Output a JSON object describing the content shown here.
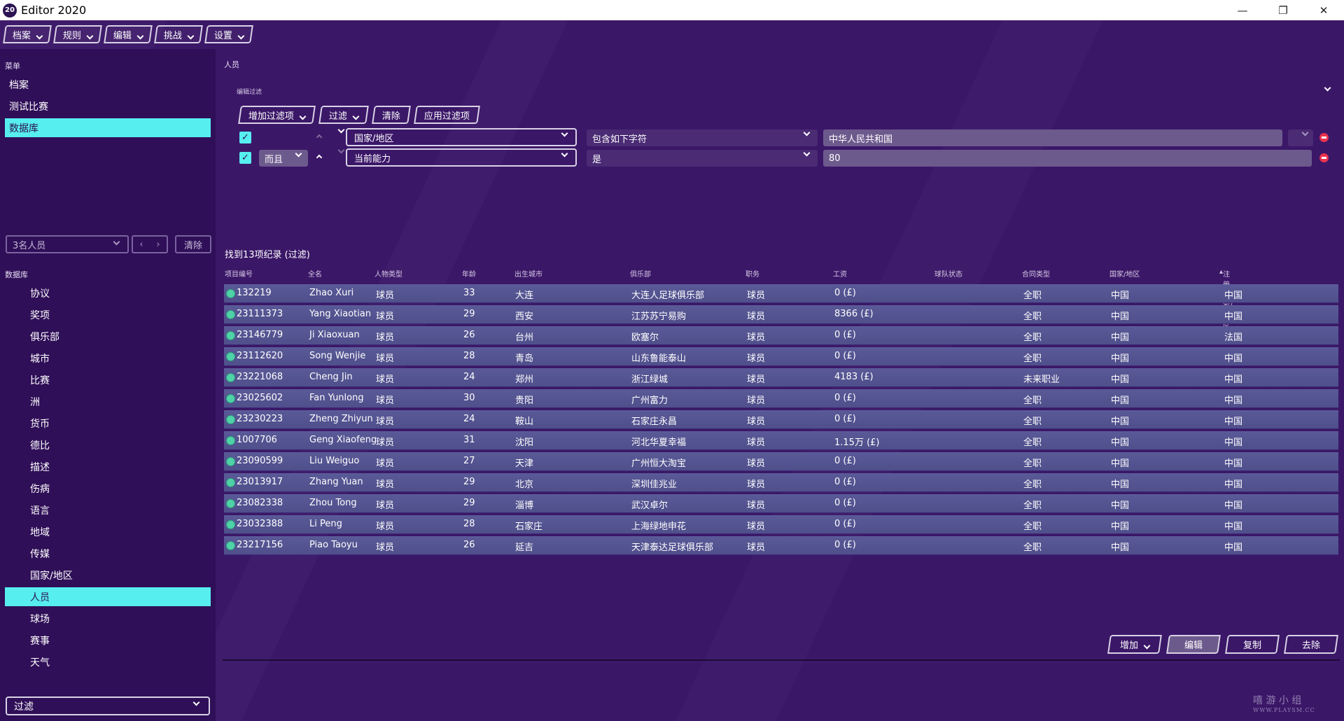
{
  "window": {
    "title": "Editor 2020",
    "icon_label": "20"
  },
  "topmenu": [
    {
      "label": "档案"
    },
    {
      "label": "规则"
    },
    {
      "label": "编辑"
    },
    {
      "label": "挑战"
    },
    {
      "label": "设置"
    }
  ],
  "sidebar": {
    "menu_heading": "菜单",
    "menu_items": [
      "档案",
      "测试比赛",
      "数据库"
    ],
    "active_menu": "数据库",
    "people_select": "3名人员",
    "clear_label": "清除",
    "db_heading": "数据库",
    "db_items": [
      "协议",
      "奖项",
      "俱乐部",
      "城市",
      "比赛",
      "洲",
      "货币",
      "德比",
      "描述",
      "伤病",
      "语言",
      "地域",
      "传媒",
      "国家/地区",
      "人员",
      "球场",
      "赛事",
      "天气"
    ],
    "active_db": "人员",
    "filter_label": "过滤"
  },
  "content": {
    "title": "人员",
    "edit_filter_label": "编辑过滤",
    "toolbar": {
      "add_filter": "增加过滤项",
      "filter": "过滤",
      "clear": "清除",
      "apply": "应用过滤项"
    },
    "filters": [
      {
        "connector": "",
        "field": "国家/地区",
        "operator": "包含如下字符",
        "value": "中华人民共和国"
      },
      {
        "connector": "而且",
        "field": "当前能力",
        "operator": "是",
        "value": "80"
      }
    ],
    "found_text": "找到13项纪录 (过滤)",
    "columns": [
      "项目编号",
      "全名",
      "人物类型",
      "年龄",
      "出生城市",
      "俱乐部",
      "职务",
      "工资",
      "球队状态",
      "合同类型",
      "国家/地区",
      "注册国家/地区"
    ],
    "rows": [
      [
        "132219",
        "Zhao Xuri",
        "球员",
        "33",
        "大连",
        "大连人足球俱乐部",
        "球员",
        "0 (£)",
        "",
        "全职",
        "中国",
        "中国"
      ],
      [
        "23111373",
        "Yang Xiaotian",
        "球员",
        "29",
        "西安",
        "江苏苏宁易购",
        "球员",
        "8366 (£)",
        "",
        "全职",
        "中国",
        "中国"
      ],
      [
        "23146779",
        "Ji Xiaoxuan",
        "球员",
        "26",
        "台州",
        "欧塞尔",
        "球员",
        "0 (£)",
        "",
        "全职",
        "中国",
        "法国"
      ],
      [
        "23112620",
        "Song Wenjie",
        "球员",
        "28",
        "青岛",
        "山东鲁能泰山",
        "球员",
        "0 (£)",
        "",
        "全职",
        "中国",
        "中国"
      ],
      [
        "23221068",
        "Cheng Jin",
        "球员",
        "24",
        "郑州",
        "浙江绿城",
        "球员",
        "4183 (£)",
        "",
        "未来职业",
        "中国",
        "中国"
      ],
      [
        "23025602",
        "Fan Yunlong",
        "球员",
        "30",
        "贵阳",
        "广州富力",
        "球员",
        "0 (£)",
        "",
        "全职",
        "中国",
        "中国"
      ],
      [
        "23230223",
        "Zheng Zhiyun",
        "球员",
        "24",
        "鞍山",
        "石家庄永昌",
        "球员",
        "0 (£)",
        "",
        "全职",
        "中国",
        "中国"
      ],
      [
        "1007706",
        "Geng Xiaofeng",
        "球员",
        "31",
        "沈阳",
        "河北华夏幸福",
        "球员",
        "1.15万 (£)",
        "",
        "全职",
        "中国",
        "中国"
      ],
      [
        "23090599",
        "Liu Weiguo",
        "球员",
        "27",
        "天津",
        "广州恒大淘宝",
        "球员",
        "0 (£)",
        "",
        "全职",
        "中国",
        "中国"
      ],
      [
        "23013917",
        "Zhang Yuan",
        "球员",
        "29",
        "北京",
        "深圳佳兆业",
        "球员",
        "0 (£)",
        "",
        "全职",
        "中国",
        "中国"
      ],
      [
        "23082338",
        "Zhou Tong",
        "球员",
        "29",
        "淄博",
        "武汉卓尔",
        "球员",
        "0 (£)",
        "",
        "全职",
        "中国",
        "中国"
      ],
      [
        "23032388",
        "Li Peng",
        "球员",
        "28",
        "石家庄",
        "上海绿地申花",
        "球员",
        "0 (£)",
        "",
        "全职",
        "中国",
        "中国"
      ],
      [
        "23217156",
        "Piao Taoyu",
        "球员",
        "26",
        "延吉",
        "天津泰达足球俱乐部",
        "球员",
        "0 (£)",
        "",
        "全职",
        "中国",
        "中国"
      ]
    ],
    "actions": {
      "add": "增加",
      "edit": "编辑",
      "copy": "复制",
      "remove": "去除"
    }
  },
  "watermark": {
    "line1": "嘻 游 小 组",
    "line2": "WWW.PLAYSM.CC"
  },
  "colors": {
    "accent": "#57eef0",
    "background": "#3b1768",
    "row": "#5a5a98",
    "remove": "#e8324f"
  }
}
